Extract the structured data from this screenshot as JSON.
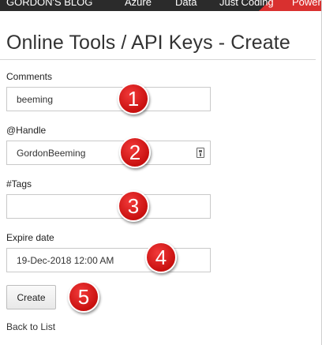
{
  "nav": {
    "items": [
      {
        "label": "GORDON'S BLOG"
      },
      {
        "label": "Azure"
      },
      {
        "label": "Data"
      },
      {
        "label": "Just Coding"
      },
      {
        "label": "Power"
      }
    ]
  },
  "page": {
    "title": "Online Tools / API Keys - Create"
  },
  "form": {
    "comments": {
      "label": "Comments",
      "value": "beeming"
    },
    "handle": {
      "label": "@Handle",
      "value": "GordonBeeming"
    },
    "tags": {
      "label": "#Tags",
      "value": ""
    },
    "expire": {
      "label": "Expire date",
      "value": "19-Dec-2018 12:00  AM"
    },
    "create_label": "Create",
    "back_label": "Back to List"
  },
  "annotations": {
    "badges": [
      "1",
      "2",
      "3",
      "4",
      "5"
    ],
    "color": "#d71a1a"
  },
  "colors": {
    "nav_background": "#2b2b2b",
    "nav_accent": "#d9302f"
  }
}
